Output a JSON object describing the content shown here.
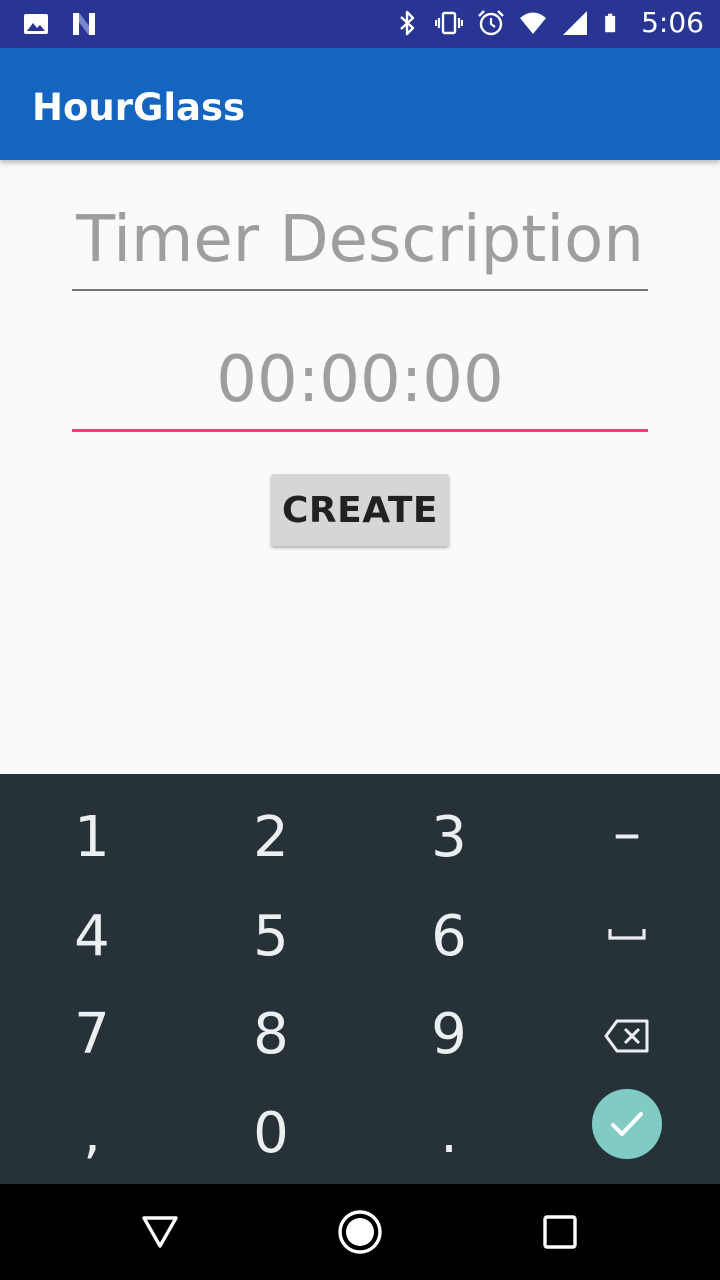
{
  "status_bar": {
    "time": "5:06",
    "left_icons": [
      "image-icon",
      "n-notification-icon"
    ],
    "right_icons": [
      "bluetooth-icon",
      "vibrate-icon",
      "alarm-icon",
      "wifi-icon",
      "cell-signal-icon",
      "battery-icon"
    ]
  },
  "app_bar": {
    "title": "HourGlass",
    "color": "#1565c0"
  },
  "form": {
    "description_placeholder": "Timer Description",
    "duration_placeholder": "00:00:00",
    "create_label": "CREATE",
    "focus_color": "#ec407a"
  },
  "keyboard": {
    "row1": [
      "1",
      "2",
      "3",
      "–"
    ],
    "row2": [
      "4",
      "5",
      "6"
    ],
    "row3": [
      "7",
      "8",
      "9"
    ],
    "row4": [
      ",",
      "0",
      "."
    ],
    "special_keys": [
      "space-icon",
      "backspace-icon",
      "done-check-icon"
    ],
    "background": "#263238",
    "accent": "#80cbc4"
  },
  "nav_bar": {
    "buttons": [
      "back-icon",
      "home-icon",
      "recents-icon"
    ]
  }
}
